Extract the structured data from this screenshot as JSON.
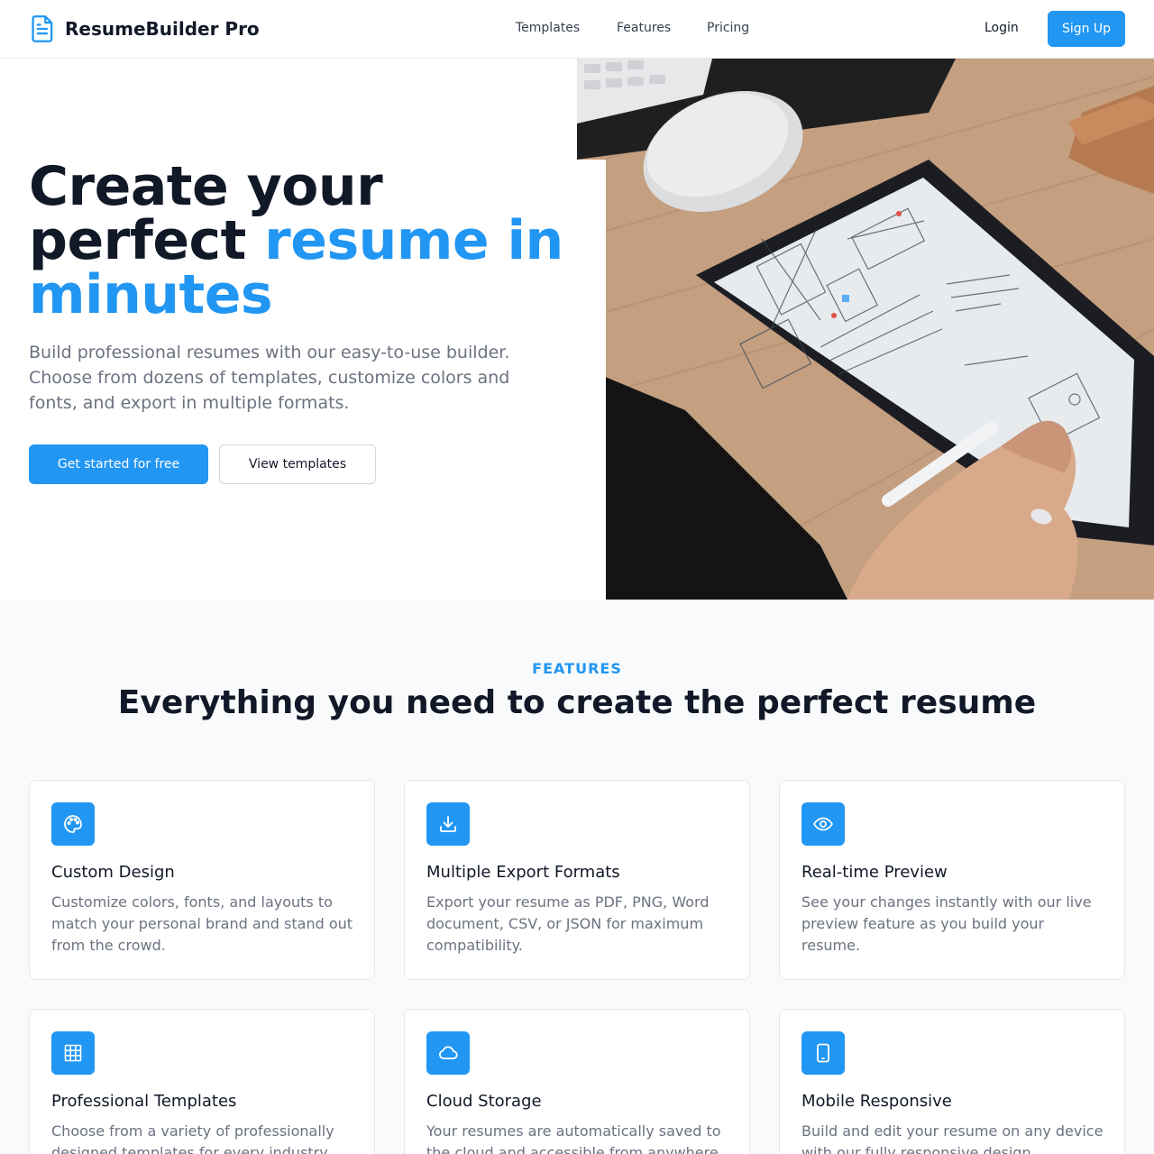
{
  "nav": {
    "brand": "ResumeBuilder Pro",
    "links": [
      "Templates",
      "Features",
      "Pricing"
    ],
    "login": "Login",
    "signup": "Sign Up"
  },
  "hero": {
    "title_line1": "Create your",
    "title_line2a": "perfect ",
    "title_line2b": "resume in",
    "title_line3": "minutes",
    "subtitle": "Build professional resumes with our easy-to-use builder. Choose from dozens of templates, customize colors and fonts, and export in multiple formats.",
    "primary_cta": "Get started for free",
    "secondary_cta": "View templates"
  },
  "features": {
    "eyebrow": "FEATURES",
    "title": "Everything you need to create the perfect resume",
    "items": [
      {
        "title": "Custom Design",
        "desc": "Customize colors, fonts, and layouts to match your personal brand and stand out from the crowd.",
        "icon": "palette-icon"
      },
      {
        "title": "Multiple Export Formats",
        "desc": "Export your resume as PDF, PNG, Word document, CSV, or JSON for maximum compatibility.",
        "icon": "download-icon"
      },
      {
        "title": "Real-time Preview",
        "desc": "See your changes instantly with our live preview feature as you build your resume.",
        "icon": "eye-icon"
      },
      {
        "title": "Professional Templates",
        "desc": "Choose from a variety of professionally designed templates for every industry.",
        "icon": "grid-icon"
      },
      {
        "title": "Cloud Storage",
        "desc": "Your resumes are automatically saved to the cloud and accessible from anywhere.",
        "icon": "cloud-icon"
      },
      {
        "title": "Mobile Responsive",
        "desc": "Build and edit your resume on any device with our fully responsive design.",
        "icon": "tablet-icon"
      }
    ]
  },
  "colors": {
    "accent": "#2196f3",
    "heading": "#111827",
    "muted": "#6b7280"
  }
}
